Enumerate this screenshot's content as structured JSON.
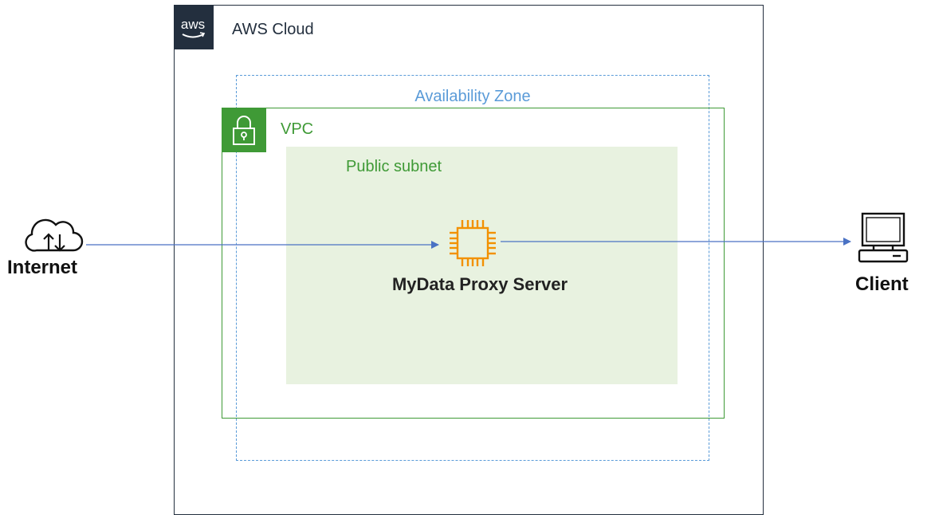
{
  "aws_cloud": {
    "title": "AWS Cloud",
    "logo_text": "aws"
  },
  "availability_zone": {
    "title": "Availability Zone"
  },
  "vpc": {
    "title": "VPC"
  },
  "public_subnet": {
    "title": "Public subnet"
  },
  "server": {
    "label": "MyData Proxy Server",
    "icon": "ec2-instance-icon"
  },
  "internet": {
    "label": "Internet",
    "icon": "cloud-upload-download-icon"
  },
  "client": {
    "label": "Client",
    "icon": "computer-icon"
  },
  "colors": {
    "aws_border": "#232f3e",
    "az_border": "#5a9bd8",
    "vpc_green": "#3f9a36",
    "subnet_fill": "#e8f2e0",
    "ec2_orange": "#f29100",
    "arrow": "#4a72c4"
  },
  "connections": [
    {
      "from": "internet",
      "to": "server"
    },
    {
      "from": "server",
      "to": "client"
    }
  ]
}
